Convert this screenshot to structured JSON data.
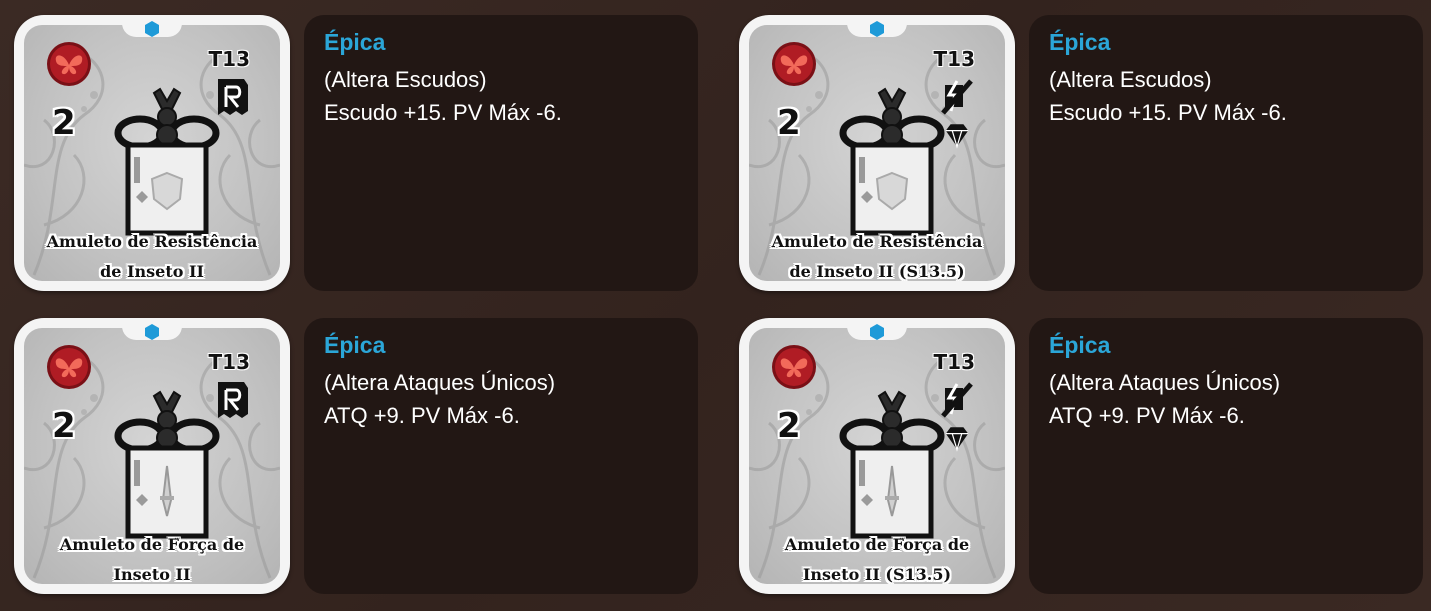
{
  "cards": [
    {
      "cost": "2",
      "tier": "T13",
      "tier_icons": [
        "reliquary-r-icon"
      ],
      "name_line1": "Amuleto de Resistência",
      "name_line2": "de Inseto II",
      "emblem": "shield",
      "rarity": "Épica",
      "effect_type": "(Altera Escudos)",
      "effect": "Escudo +15. PV Máx -6."
    },
    {
      "cost": "2",
      "tier": "T13",
      "tier_icons": [
        "crossed-out-icon",
        "diamond-icon"
      ],
      "name_line1": "Amuleto de Resistência",
      "name_line2": "de Inseto II (S13.5)",
      "emblem": "shield",
      "rarity": "Épica",
      "effect_type": "(Altera Escudos)",
      "effect": "Escudo +15. PV Máx -6."
    },
    {
      "cost": "2",
      "tier": "T13",
      "tier_icons": [
        "reliquary-r-icon"
      ],
      "name_line1": "Amuleto de Força de",
      "name_line2": "Inseto II",
      "emblem": "sword",
      "rarity": "Épica",
      "effect_type": "(Altera Ataques Únicos)",
      "effect": "ATQ +9. PV Máx -6."
    },
    {
      "cost": "2",
      "tier": "T13",
      "tier_icons": [
        "crossed-out-icon",
        "diamond-icon"
      ],
      "name_line1": "Amuleto de Força de",
      "name_line2": "Inseto II (S13.5)",
      "emblem": "sword",
      "rarity": "Épica",
      "effect_type": "(Altera Ataques Únicos)",
      "effect": "ATQ +9. PV Máx -6."
    }
  ],
  "colors": {
    "rarity": "#2ba6d8",
    "gem": "#1e9ad8",
    "badge": "#b01c24",
    "panel": "#221714"
  }
}
